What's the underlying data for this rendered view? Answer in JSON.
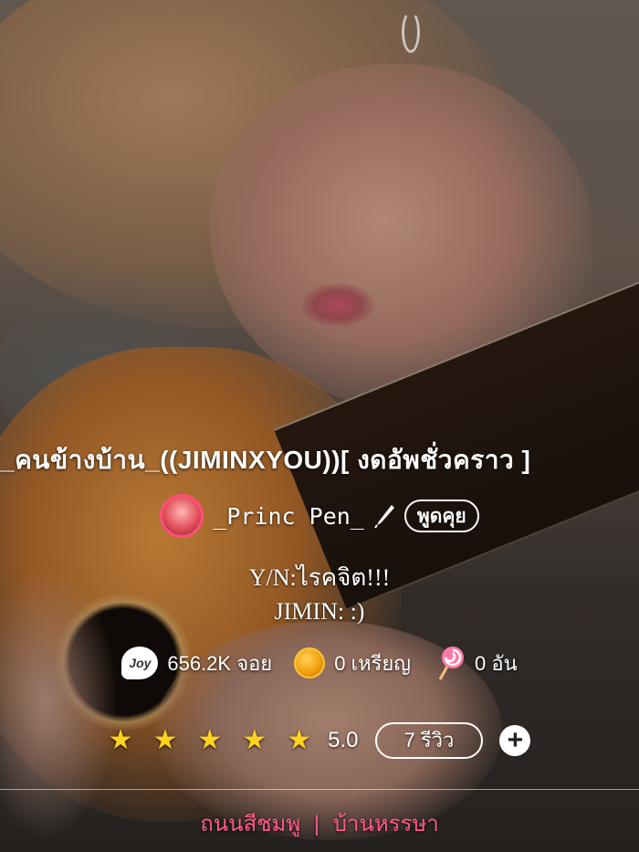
{
  "story": {
    "title": "_คนข้างบ้าน_((JIMINXYOU))[ งดอัพชั่วคราว ]",
    "author": {
      "name": "_Princ Pen_",
      "avatar_icon": "avatar-cake-icon",
      "pen_icon": "pen-icon",
      "chat_label": "พูดคุย"
    },
    "description": {
      "line1": "Y/N:ไรคจิต!!!",
      "line2": "JIMIN: :)"
    },
    "stats": {
      "joy": {
        "icon": "joy-icon",
        "value": "656.2K จอย"
      },
      "coin": {
        "icon": "coin-icon",
        "value": "0 เหรียญ"
      },
      "lollipop": {
        "icon": "lollipop-icon",
        "value": "0 อัน"
      }
    },
    "rating": {
      "stars": 5,
      "score": "5.0",
      "reviews_label": "7 รีวิว",
      "add_icon": "plus-icon"
    },
    "tags": [
      "ถนนสีชมพู",
      "บ้านหรรษา"
    ],
    "tag_separator": "|"
  },
  "colors": {
    "accent_pink": "#ff5a8a",
    "avatar_ring": "#ff4f7b",
    "star": "#ffd21f",
    "coin": "#f2a10c"
  }
}
